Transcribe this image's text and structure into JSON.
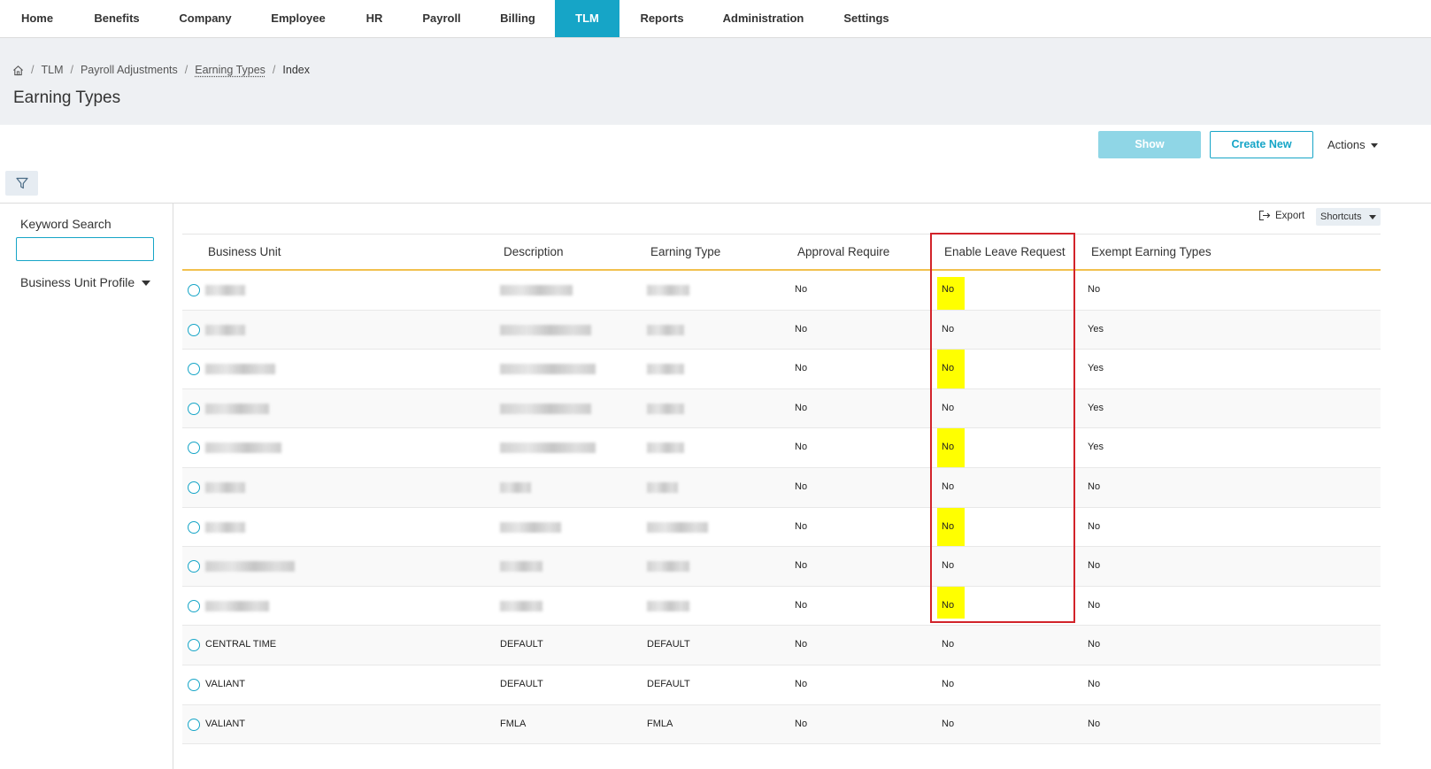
{
  "nav": {
    "items": [
      {
        "label": "Home"
      },
      {
        "label": "Benefits"
      },
      {
        "label": "Company"
      },
      {
        "label": "Employee"
      },
      {
        "label": "HR"
      },
      {
        "label": "Payroll"
      },
      {
        "label": "Billing"
      },
      {
        "label": "TLM"
      },
      {
        "label": "Reports"
      },
      {
        "label": "Administration"
      },
      {
        "label": "Settings"
      }
    ],
    "active": "TLM",
    "active_color": "#16a5c7"
  },
  "breadcrumb": {
    "items": [
      "TLM",
      "Payroll Adjustments",
      "Earning Types",
      "Index"
    ]
  },
  "page": {
    "title": "Earning Types"
  },
  "toolbar": {
    "show_label": "Show",
    "create_label": "Create New",
    "actions_label": "Actions",
    "export_label": "Export",
    "shortcuts_label": "Shortcuts"
  },
  "filters": {
    "keyword_label": "Keyword Search",
    "keyword_value": "",
    "profile_label": "Business Unit Profile"
  },
  "table": {
    "columns": [
      "Business Unit",
      "Description",
      "Earning Type",
      "Approval Require",
      "Enable Leave Request",
      "Exempt Earning Types"
    ],
    "rows": [
      {
        "business_unit": "",
        "description": "",
        "earning_type": "",
        "approval": "No",
        "leave": "No",
        "exempt": "No"
      },
      {
        "business_unit": "",
        "description": "",
        "earning_type": "",
        "approval": "No",
        "leave": "No",
        "exempt": "Yes"
      },
      {
        "business_unit": "",
        "description": "",
        "earning_type": "",
        "approval": "No",
        "leave": "No",
        "exempt": "Yes"
      },
      {
        "business_unit": "",
        "description": "",
        "earning_type": "",
        "approval": "No",
        "leave": "No",
        "exempt": "Yes"
      },
      {
        "business_unit": "",
        "description": "",
        "earning_type": "",
        "approval": "No",
        "leave": "No",
        "exempt": "Yes"
      },
      {
        "business_unit": "",
        "description": "",
        "earning_type": "",
        "approval": "No",
        "leave": "No",
        "exempt": "No"
      },
      {
        "business_unit": "",
        "description": "",
        "earning_type": "",
        "approval": "No",
        "leave": "No",
        "exempt": "No"
      },
      {
        "business_unit": "",
        "description": "",
        "earning_type": "",
        "approval": "No",
        "leave": "No",
        "exempt": "No"
      },
      {
        "business_unit": "",
        "description": "",
        "earning_type": "",
        "approval": "No",
        "leave": "No",
        "exempt": "No"
      },
      {
        "business_unit": "CENTRAL TIME",
        "description": "DEFAULT",
        "earning_type": "DEFAULT",
        "approval": "No",
        "leave": "No",
        "exempt": "No"
      },
      {
        "business_unit": "VALIANT",
        "description": "DEFAULT",
        "earning_type": "DEFAULT",
        "approval": "No",
        "leave": "No",
        "exempt": "No"
      },
      {
        "business_unit": "VALIANT",
        "description": "FMLA",
        "earning_type": "FMLA",
        "approval": "No",
        "leave": "No",
        "exempt": "No"
      }
    ]
  },
  "annotation": {
    "highlight_color": "#ffff00",
    "box_color": "#d2232a"
  }
}
